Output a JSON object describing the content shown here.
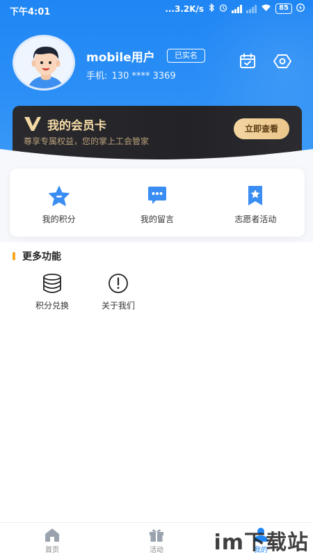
{
  "status_bar": {
    "time": "下午4:01",
    "network_speed": "...3.2K/s",
    "battery": "85"
  },
  "profile": {
    "username": "mobile用户",
    "verified_badge": "已实名",
    "phone_label": "手机:",
    "phone_value": "130 **** 3369",
    "icons": [
      "calendar-check-icon",
      "settings-hexagon-icon"
    ]
  },
  "member_card": {
    "title": "我的会员卡",
    "subtitle": "尊享专属权益，您的掌上工会管家",
    "button": "立即查看",
    "colors": {
      "card_bg": "#26262a",
      "gold": "#f3d9a4",
      "button_bg": "#f0cf97"
    }
  },
  "quick_actions": [
    {
      "label": "我的积分",
      "icon": "star-icon"
    },
    {
      "label": "我的留言",
      "icon": "chat-bubble-icon"
    },
    {
      "label": "志愿者活动",
      "icon": "bookmark-star-icon"
    }
  ],
  "more_section": {
    "title": "更多功能",
    "items": [
      {
        "label": "积分兑换",
        "icon": "database-icon"
      },
      {
        "label": "关于我们",
        "icon": "info-circle-icon"
      }
    ]
  },
  "bottom_nav": [
    {
      "label": "首页",
      "icon": "home-icon",
      "active": false
    },
    {
      "label": "活动",
      "icon": "gift-icon",
      "active": false
    },
    {
      "label": "我的",
      "icon": "user-icon",
      "active": true
    }
  ],
  "watermark": "im下载站",
  "colors": {
    "primary": "#1f86f4",
    "accent": "#f5a623"
  }
}
